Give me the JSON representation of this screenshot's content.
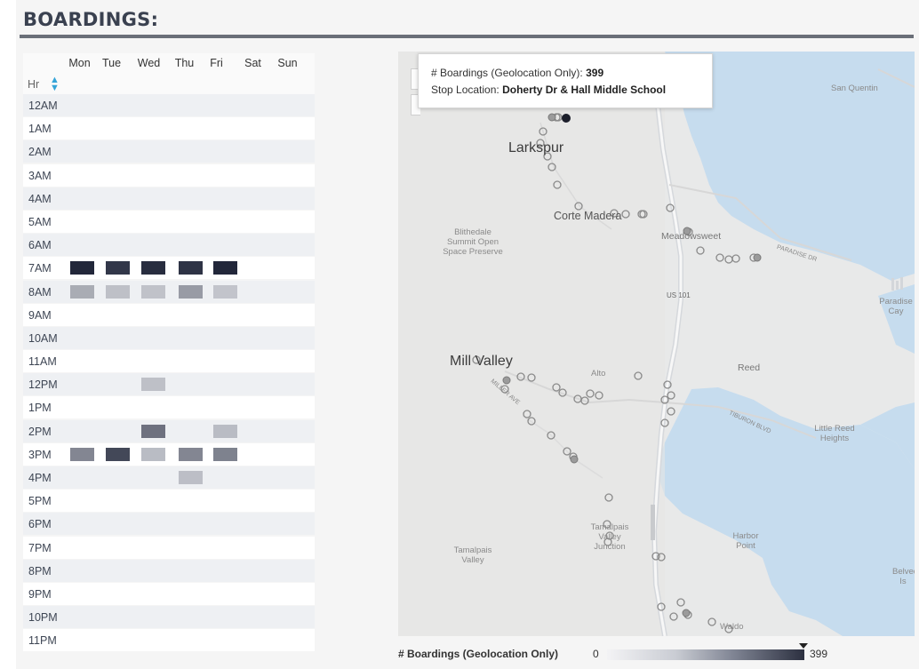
{
  "title": "BOARDINGS:",
  "heatmap": {
    "days": [
      "Mon",
      "Tue",
      "Wed",
      "Thu",
      "Fri",
      "Sat",
      "Sun"
    ],
    "sort_label": "Hr",
    "sort_icon": "sort-icon",
    "hours": [
      "12AM",
      "1AM",
      "2AM",
      "3AM",
      "4AM",
      "5AM",
      "6AM",
      "7AM",
      "8AM",
      "9AM",
      "10AM",
      "11AM",
      "12PM",
      "1PM",
      "2PM",
      "3PM",
      "4PM",
      "5PM",
      "6PM",
      "7PM",
      "8PM",
      "9PM",
      "10PM",
      "11PM"
    ],
    "values_scale_max": 399,
    "values": [
      [
        0,
        0,
        0,
        0,
        0,
        0,
        0
      ],
      [
        0,
        0,
        0,
        0,
        0,
        0,
        0
      ],
      [
        0,
        0,
        0,
        0,
        0,
        0,
        0
      ],
      [
        0,
        0,
        0,
        0,
        0,
        0,
        0
      ],
      [
        0,
        0,
        0,
        0,
        0,
        0,
        0
      ],
      [
        0,
        0,
        0,
        0,
        0,
        0,
        0
      ],
      [
        0,
        0,
        0,
        0,
        0,
        0,
        0
      ],
      [
        399,
        360,
        385,
        370,
        399,
        0,
        0
      ],
      [
        80,
        30,
        25,
        120,
        20,
        0,
        0
      ],
      [
        0,
        0,
        0,
        0,
        0,
        0,
        0
      ],
      [
        0,
        0,
        0,
        0,
        0,
        0,
        0
      ],
      [
        0,
        0,
        0,
        0,
        0,
        0,
        0
      ],
      [
        0,
        0,
        30,
        0,
        0,
        0,
        0
      ],
      [
        0,
        0,
        0,
        0,
        0,
        0,
        0
      ],
      [
        0,
        0,
        220,
        0,
        40,
        0,
        0
      ],
      [
        170,
        320,
        40,
        170,
        180,
        0,
        0
      ],
      [
        0,
        0,
        0,
        35,
        0,
        0,
        0
      ],
      [
        0,
        0,
        0,
        0,
        0,
        0,
        0
      ],
      [
        0,
        0,
        0,
        0,
        0,
        0,
        0
      ],
      [
        0,
        0,
        0,
        0,
        0,
        0,
        0
      ],
      [
        0,
        0,
        0,
        0,
        0,
        0,
        0
      ],
      [
        0,
        0,
        0,
        0,
        0,
        0,
        0
      ],
      [
        0,
        0,
        0,
        0,
        0,
        0,
        0
      ],
      [
        0,
        0,
        0,
        0,
        0,
        0,
        0
      ]
    ]
  },
  "tooltip": {
    "measure_label": "# Boardings (Geolocation Only):",
    "measure_value": "399",
    "stop_label": "Stop Location:",
    "stop_value": "Doherty Dr & Hall Middle School"
  },
  "map": {
    "places": {
      "larkspur": "Larkspur",
      "corte_madera": "Corte Madera",
      "mill_valley": "Mill Valley",
      "san_quentin": "San Quentin",
      "blithedale": "Blithedale Summit Open Space Preserve",
      "meadowsweet": "Meadowsweet",
      "paradise_cay": "Paradise Cay",
      "reed": "Reed",
      "alto": "Alto",
      "little_reed_heights": "Little Reed Heights",
      "tamalpais_valley_junction": "Tamalpais Valley Junction",
      "tamalpais_valley": "Tamalpais Valley",
      "harbor_point": "Harbor Point",
      "belvedere": "Belvedere Is",
      "waldo": "Waldo",
      "us101": "US 101",
      "paradise_dr": "PARADISE DR",
      "tiburon_blvd": "TIBURON BLVD",
      "miller_ave": "MILLER AVE"
    }
  },
  "legend": {
    "label": "# Boardings (Geolocation Only)",
    "min": "0",
    "max": "399"
  },
  "colors": {
    "title": "#3a4150",
    "rule": "#6a6f78",
    "heat_low": "#eef0f3",
    "heat_high": "#22273a",
    "sort_icon": "#35a4d8",
    "water": "#c6dcee",
    "land": "#e8e9e9"
  }
}
